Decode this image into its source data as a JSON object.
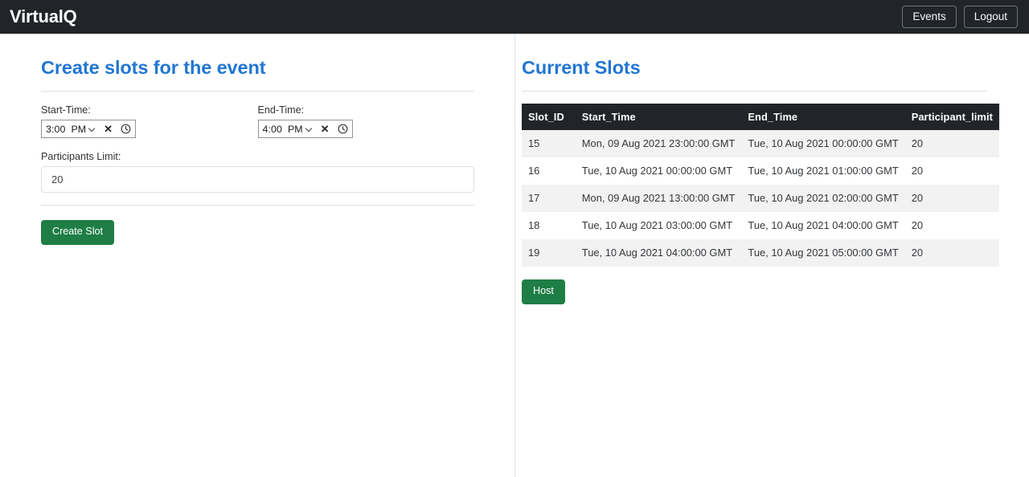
{
  "navbar": {
    "brand": "VirtualQ",
    "buttons": [
      {
        "label": "Events",
        "name": "events-button"
      },
      {
        "label": "Logout",
        "name": "logout-button"
      }
    ]
  },
  "create_panel": {
    "title": "Create slots for the event",
    "start_time": {
      "label": "Start-Time:",
      "value": "3:00",
      "meridiem": "PM",
      "clear_glyph": "✕",
      "clock_icon": "clock-icon"
    },
    "end_time": {
      "label": "End-Time:",
      "value": "4:00",
      "meridiem": "PM",
      "clear_glyph": "✕",
      "clock_icon": "clock-icon"
    },
    "participants": {
      "label": "Participants Limit:",
      "value": "20",
      "placeholder": "20"
    },
    "submit_label": "Create Slot"
  },
  "slots_panel": {
    "title": "Current Slots",
    "columns": [
      "Slot_ID",
      "Start_Time",
      "End_Time",
      "Participant_limit"
    ],
    "rows": [
      {
        "id": "15",
        "start": "Mon, 09 Aug 2021 23:00:00 GMT",
        "end": "Tue, 10 Aug 2021 00:00:00 GMT",
        "limit": "20"
      },
      {
        "id": "16",
        "start": "Tue, 10 Aug 2021 00:00:00 GMT",
        "end": "Tue, 10 Aug 2021 01:00:00 GMT",
        "limit": "20"
      },
      {
        "id": "17",
        "start": "Mon, 09 Aug 2021 13:00:00 GMT",
        "end": "Tue, 10 Aug 2021 02:00:00 GMT",
        "limit": "20"
      },
      {
        "id": "18",
        "start": "Tue, 10 Aug 2021 03:00:00 GMT",
        "end": "Tue, 10 Aug 2021 04:00:00 GMT",
        "limit": "20"
      },
      {
        "id": "19",
        "start": "Tue, 10 Aug 2021 04:00:00 GMT",
        "end": "Tue, 10 Aug 2021 05:00:00 GMT",
        "limit": "20"
      }
    ],
    "host_label": "Host"
  },
  "colors": {
    "navbar_bg": "#212529",
    "heading_blue": "#2176d2",
    "success_green": "#1e7e45",
    "table_header_bg": "#212529",
    "row_stripe": "#f2f2f2"
  }
}
